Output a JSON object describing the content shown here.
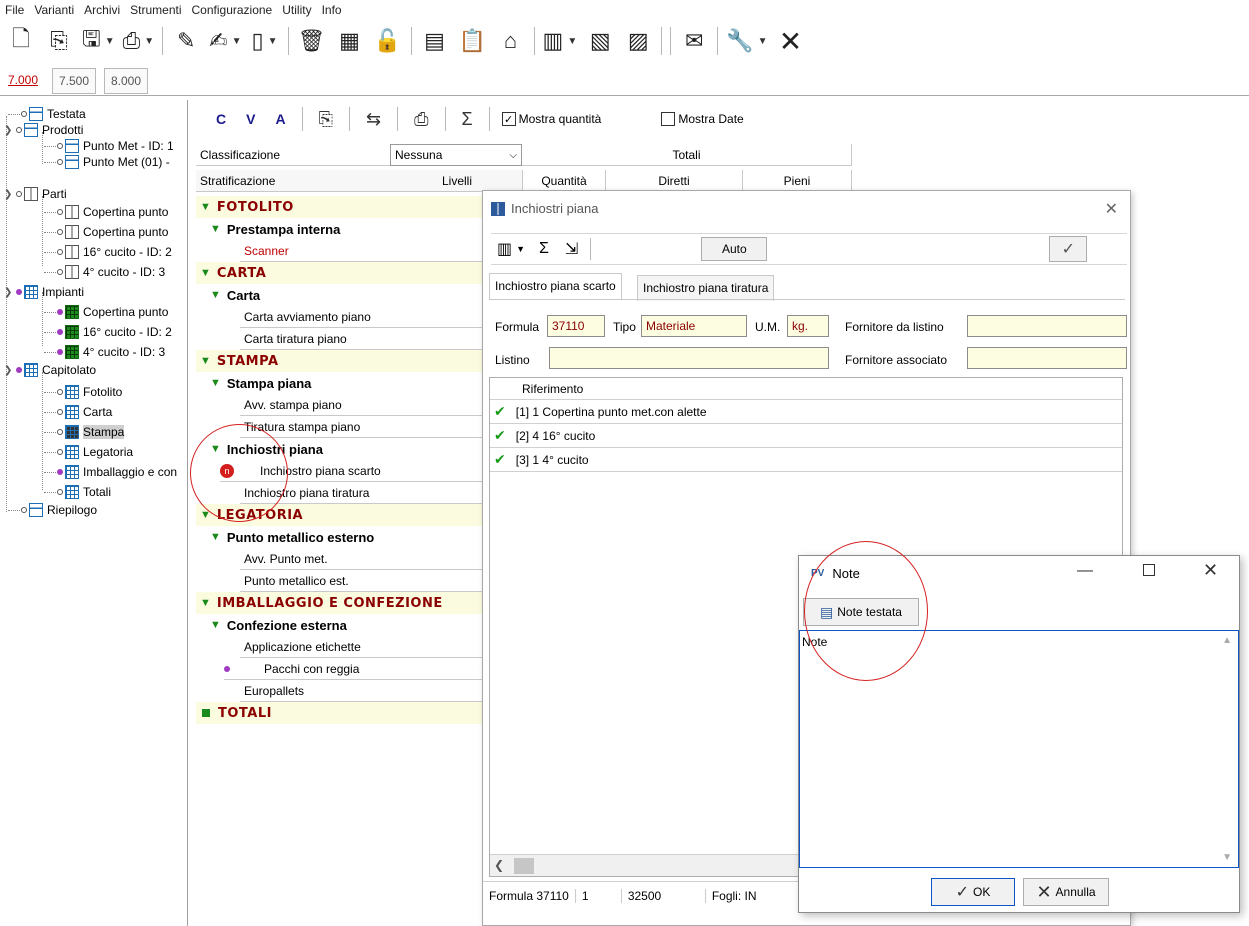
{
  "menu": [
    "File",
    "Varianti",
    "Archivi",
    "Strumenti",
    "Configurazione",
    "Utility",
    "Info"
  ],
  "version_tabs": [
    "7.000",
    "7.500",
    "8.000"
  ],
  "tree": {
    "testata": "Testata",
    "prodotti": "Prodotti",
    "prodotti_items": [
      "Punto Met - ID: 1",
      "Punto Met (01) -"
    ],
    "parti": "Parti",
    "parti_items": [
      "Copertina punto",
      "Copertina punto",
      "16° cucito - ID: 2",
      "4° cucito  - ID: 3"
    ],
    "impianti": "Impianti",
    "impianti_items": [
      "Copertina punto",
      "16° cucito - ID: 2",
      "4° cucito  - ID: 3"
    ],
    "capitolato": "Capitolato",
    "capitolato_items": [
      "Fotolito",
      "Carta",
      "Stampa",
      "Legatoria",
      "Imballaggio e con",
      "Totali"
    ],
    "riepilogo": "Riepilogo"
  },
  "main_toolbar": {
    "c": "C",
    "v": "V",
    "a": "A",
    "mostra_quantita": "Mostra quantità",
    "mostra_date": "Mostra Date"
  },
  "grid": {
    "classificazione_label": "Classificazione",
    "classificazione_value": "Nessuna",
    "totali": "Totali",
    "stratificazione": "Stratificazione",
    "livelli": "Livelli",
    "quantita": "Quantità",
    "diretti": "Diretti",
    "pieni": "Pieni",
    "rows": [
      {
        "type": "cat",
        "text": "FOTOLITO"
      },
      {
        "type": "sub",
        "text": "Prestampa interna"
      },
      {
        "type": "item",
        "text": "Scanner",
        "red": true
      },
      {
        "type": "cat",
        "text": "CARTA"
      },
      {
        "type": "sub",
        "text": "Carta"
      },
      {
        "type": "item",
        "text": "Carta avviamento piano"
      },
      {
        "type": "item",
        "text": "Carta tiratura piano"
      },
      {
        "type": "cat",
        "text": "STAMPA"
      },
      {
        "type": "sub",
        "text": "Stampa piana"
      },
      {
        "type": "item",
        "text": "Avv. stampa piano"
      },
      {
        "type": "item",
        "text": "Tiratura stampa piano"
      },
      {
        "type": "sub",
        "text": "Inchiostri piana"
      },
      {
        "type": "item",
        "text": "Inchiostro piana scarto",
        "badge": "note"
      },
      {
        "type": "item",
        "text": "Inchiostro piana tiratura"
      },
      {
        "type": "cat",
        "text": "LEGATORIA"
      },
      {
        "type": "sub",
        "text": "Punto metallico esterno"
      },
      {
        "type": "item",
        "text": "Avv. Punto met."
      },
      {
        "type": "item",
        "text": "Punto metallico est."
      },
      {
        "type": "cat",
        "text": "IMBALLAGGIO E CONFEZIONE"
      },
      {
        "type": "sub",
        "text": "Confezione esterna"
      },
      {
        "type": "item",
        "text": "Applicazione etichette"
      },
      {
        "type": "item",
        "text": "Pacchi con reggia",
        "badge": "dot"
      },
      {
        "type": "item",
        "text": "Europallets"
      },
      {
        "type": "total",
        "text": "TOTALI"
      }
    ]
  },
  "ink_dialog": {
    "title": "Inchiostri piana",
    "auto": "Auto",
    "tab_scarto": "Inchiostro piana scarto",
    "tab_tiratura": "Inchiostro piana tiratura",
    "formula_label": "Formula",
    "formula_value": "37110",
    "tipo_label": "Tipo",
    "tipo_value": "Materiale",
    "um_label": "U.M.",
    "um_value": "kg.",
    "fornitore_listino_label": "Fornitore da listino",
    "listino_label": "Listino",
    "fornitore_associato_label": "Fornitore associato",
    "riferimento_header": "Riferimento",
    "riferimenti": [
      "[1] 1 Copertina punto met.con alette",
      "[2] 4 16° cucito",
      "[3] 1 4° cucito"
    ],
    "status": [
      "Formula 37110",
      "1",
      "32500",
      "Fogli: IN"
    ]
  },
  "note_dialog": {
    "title": "Note",
    "note_testata": "Note testata",
    "text": "Note",
    "ok": "OK",
    "annulla": "Annulla"
  }
}
